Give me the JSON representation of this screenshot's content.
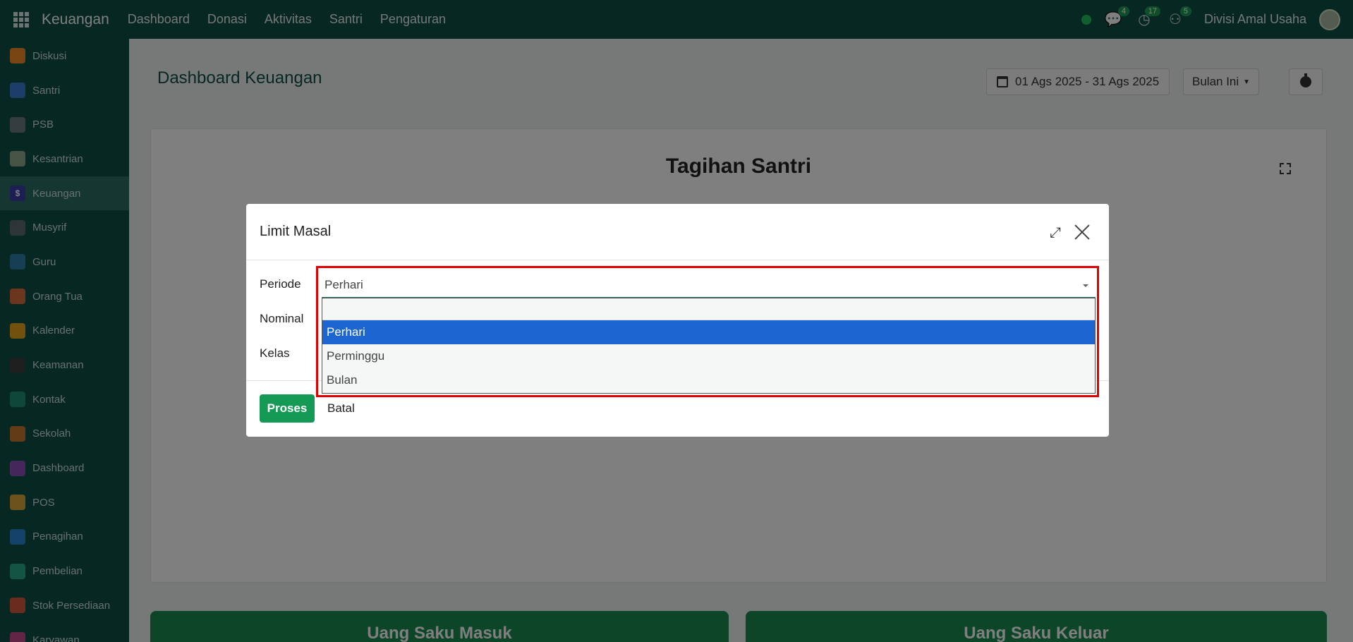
{
  "topbar": {
    "brand": "Keuangan",
    "menu": [
      "Dashboard",
      "Donasi",
      "Aktivitas",
      "Santri",
      "Pengaturan"
    ],
    "badges": {
      "chat": "4",
      "activity": "17",
      "notif": "5"
    },
    "user": "Divisi Amal Usaha"
  },
  "sidebar": {
    "items": [
      {
        "label": "Diskusi",
        "color": "#f08a24"
      },
      {
        "label": "Santri",
        "color": "#3b7bd6"
      },
      {
        "label": "PSB",
        "color": "#6c7b80"
      },
      {
        "label": "Kesantrian",
        "color": "#8fa98a"
      },
      {
        "label": "Keuangan",
        "color": "#3a3da8",
        "active": true
      },
      {
        "label": "Musyrif",
        "color": "#5a6a70"
      },
      {
        "label": "Guru",
        "color": "#2f7fa6"
      },
      {
        "label": "Orang Tua",
        "color": "#d96a3a"
      },
      {
        "label": "Kalender",
        "color": "#e3a21a"
      },
      {
        "label": "Keamanan",
        "color": "#3e3e3e"
      },
      {
        "label": "Kontak",
        "color": "#1f8f72"
      },
      {
        "label": "Sekolah",
        "color": "#c9762e"
      },
      {
        "label": "Dashboard",
        "color": "#8a4fb8"
      },
      {
        "label": "POS",
        "color": "#d9a43a"
      },
      {
        "label": "Penagihan",
        "color": "#2b84d6"
      },
      {
        "label": "Pembelian",
        "color": "#27a889"
      },
      {
        "label": "Stok Persediaan",
        "color": "#d45b3a"
      },
      {
        "label": "Karyawan",
        "color": "#c74a8a"
      }
    ]
  },
  "main": {
    "title": "Dashboard Keuangan",
    "date_range": "01 Ags 2025 - 31 Ags 2025",
    "period": "Bulan Ini",
    "card_title": "Tagihan Santri",
    "bottom_left": "Uang Saku Masuk",
    "bottom_right": "Uang Saku Keluar"
  },
  "modal": {
    "title": "Limit Masal",
    "labels": {
      "periode": "Periode",
      "nominal": "Nominal",
      "kelas": "Kelas"
    },
    "select_value": "Perhari",
    "options": [
      "Perhari",
      "Perminggu",
      "Bulan"
    ],
    "selected_index": 0,
    "btn_proses": "Proses",
    "btn_batal": "Batal"
  }
}
